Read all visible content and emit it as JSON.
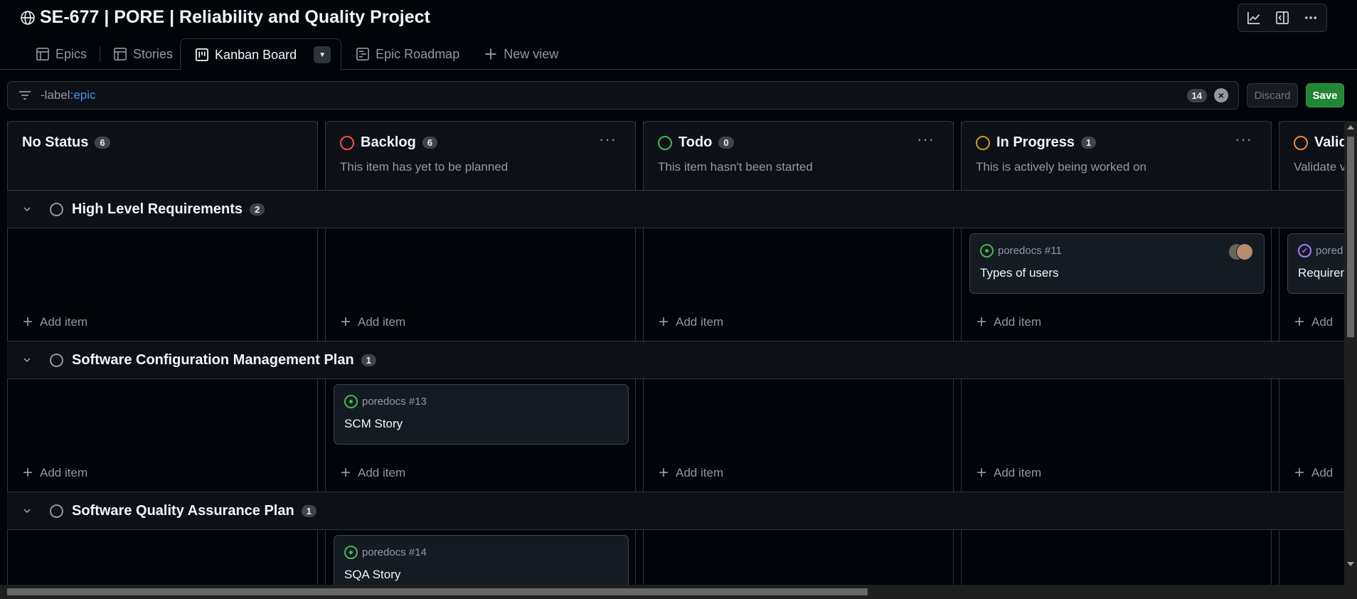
{
  "project": {
    "title": "SE-677 | PORE | Reliability and Quality Project"
  },
  "tabs": [
    {
      "label": "Epics",
      "icon": "table-icon"
    },
    {
      "label": "Stories",
      "icon": "table-icon"
    },
    {
      "label": "Kanban Board",
      "icon": "board-icon",
      "active": true
    },
    {
      "label": "Epic Roadmap",
      "icon": "roadmap-icon"
    },
    {
      "label": "New view",
      "icon": "plus-icon"
    }
  ],
  "header_buttons": [
    "insights-icon",
    "side-panel-icon",
    "more-icon"
  ],
  "filter": {
    "prefix": "-label:",
    "value": "epic",
    "count": "14",
    "discard_label": "Discard",
    "save_label": "Save"
  },
  "columns": [
    {
      "name": "No Status",
      "count": "6",
      "description": "",
      "status_color": ""
    },
    {
      "name": "Backlog",
      "count": "6",
      "description": "This item has yet to be planned",
      "status_color": "#f85149"
    },
    {
      "name": "Todo",
      "count": "0",
      "description": "This item hasn't been started",
      "status_color": "#3fb950"
    },
    {
      "name": "In Progress",
      "count": "1",
      "description": "This is actively being worked on",
      "status_color": "#d29922"
    },
    {
      "name": "Valid",
      "count": "",
      "description": "Validate v",
      "status_color": "#f0883e"
    }
  ],
  "groups": [
    {
      "title": "High Level Requirements",
      "count": "2",
      "cards": [
        {
          "column": 3,
          "repo": "poredocs #11",
          "title": "Types of users",
          "state": "open",
          "has_avatars": true
        },
        {
          "column": 4,
          "repo": "pored",
          "title": "Requiren",
          "state": "done"
        }
      ]
    },
    {
      "title": "Software Configuration Management Plan",
      "count": "1",
      "cards": [
        {
          "column": 1,
          "repo": "poredocs #13",
          "title": "SCM Story",
          "state": "open"
        }
      ]
    },
    {
      "title": "Software Quality Assurance Plan",
      "count": "1",
      "cards": [
        {
          "column": 1,
          "repo": "poredocs #14",
          "title": "SQA Story",
          "state": "open"
        }
      ]
    }
  ],
  "add_item_label": "Add item",
  "add_item_truncated": "Add",
  "colors": {
    "accent": "#4493f8",
    "save": "#238636",
    "background": "#010409"
  }
}
